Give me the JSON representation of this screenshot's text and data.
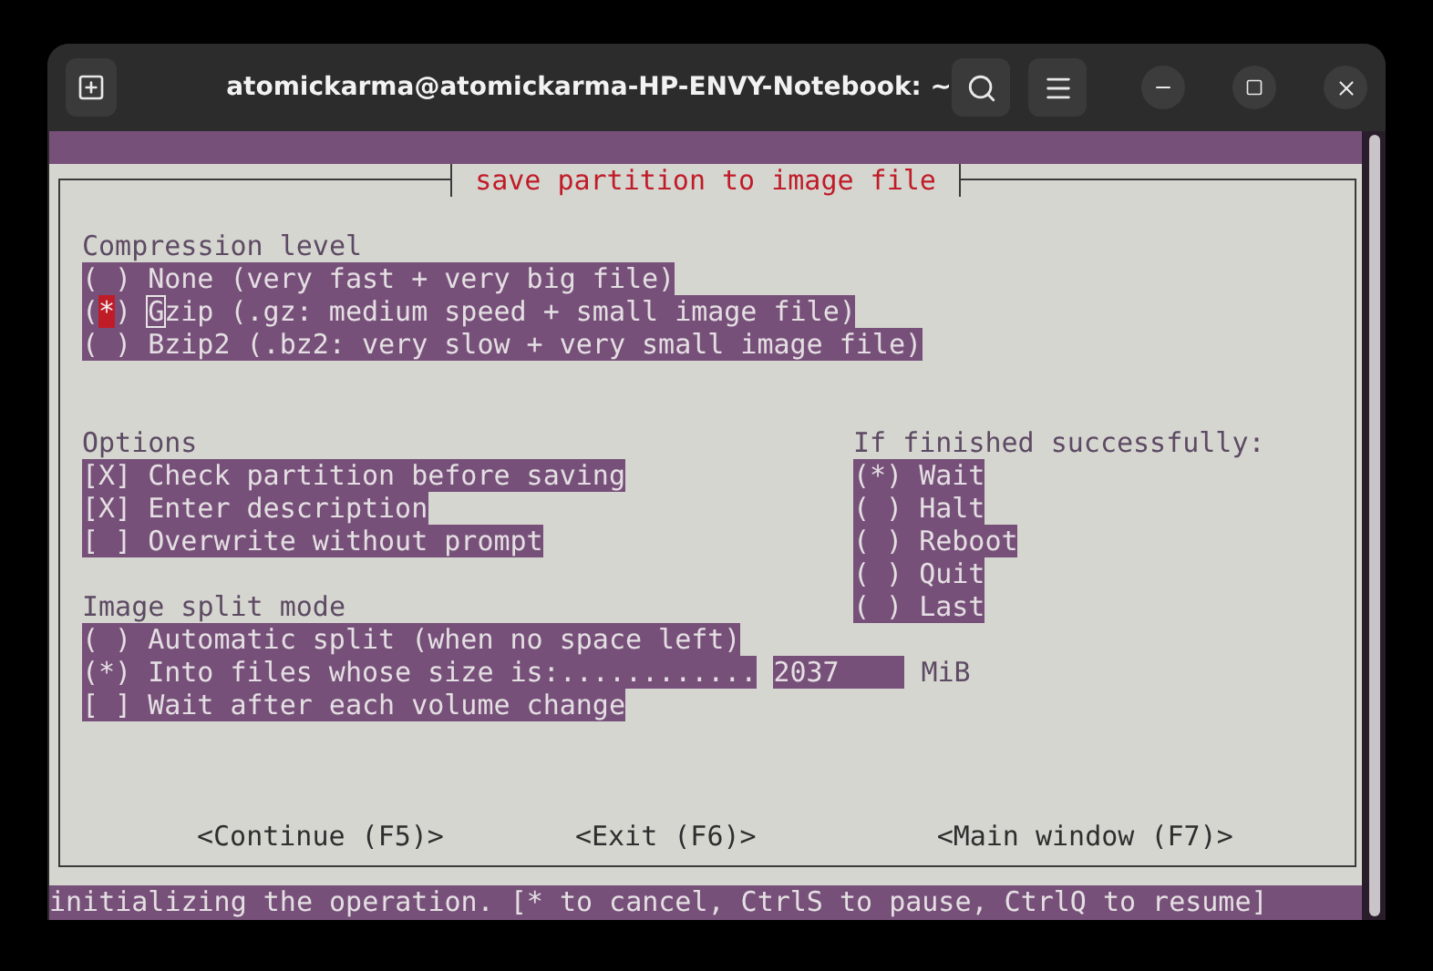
{
  "window": {
    "title": "atomickarma@atomickarma-HP-ENVY-Notebook: ~"
  },
  "dialog": {
    "title": "save partition to image file",
    "compression": {
      "label": "Compression level",
      "options": [
        {
          "open": "(",
          "close": ")",
          "label": "None (very fast + very big file)",
          "selected": false,
          "focused": false
        },
        {
          "open": "(",
          "dot": "*",
          "close": ")",
          "label": "Gzip (.gz: medium speed + small image file)",
          "selected": true,
          "focused": true
        },
        {
          "open": "(",
          "close": ")",
          "label": "Bzip2 (.bz2: very slow + very small image file)",
          "selected": false,
          "focused": false
        }
      ]
    },
    "options": {
      "label": "Options",
      "items": [
        {
          "open": "[",
          "dot": "X",
          "close": "]",
          "label": "Check partition before saving",
          "checked": true
        },
        {
          "open": "[",
          "dot": "X",
          "close": "]",
          "label": "Enter description",
          "checked": true
        },
        {
          "open": "[",
          "close": "]",
          "label": "Overwrite without prompt",
          "checked": false
        }
      ]
    },
    "split": {
      "label": "Image split mode",
      "items": [
        {
          "kind": "radio",
          "open": "(",
          "close": ")",
          "label": "Automatic split (when no space left)",
          "selected": false
        },
        {
          "kind": "size",
          "open": "(",
          "dot": "*",
          "close": ")",
          "label": "Into files whose size is:............",
          "selected": true,
          "value": "2037",
          "unit": "MiB"
        },
        {
          "kind": "check",
          "open": "[",
          "close": "]",
          "label": "Wait after each volume change",
          "checked": false
        }
      ]
    },
    "finish": {
      "label": "If finished successfully:",
      "options": [
        {
          "open": "(",
          "dot": "*",
          "close": ")",
          "label": "Wait",
          "selected": true
        },
        {
          "open": "(",
          "close": ")",
          "label": "Halt",
          "selected": false
        },
        {
          "open": "(",
          "close": ")",
          "label": "Reboot",
          "selected": false
        },
        {
          "open": "(",
          "close": ")",
          "label": "Quit",
          "selected": false
        },
        {
          "open": "(",
          "close": ")",
          "label": "Last",
          "selected": false
        }
      ]
    },
    "buttons": [
      "<Continue (F5)>",
      "<Exit (F6)>",
      "<Main window (F7)>"
    ]
  },
  "status_bar": "initializing the operation. [* to cancel, CtrlS to pause, CtrlQ to resume]"
}
